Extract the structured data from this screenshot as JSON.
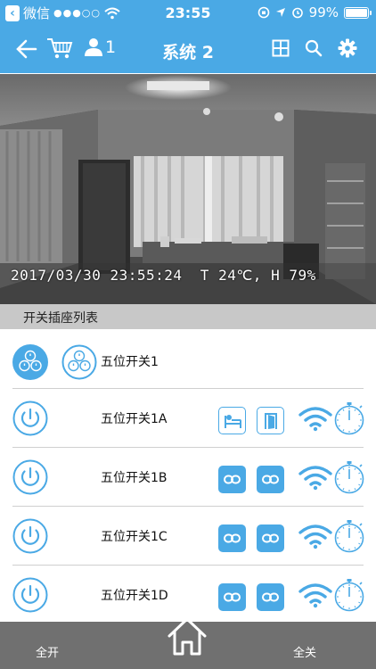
{
  "status_bar": {
    "back_glyph": "‹",
    "carrier": "微信",
    "signal": "●●●○○",
    "time": "23:55",
    "battery": "99%",
    "battery_level": 0.99
  },
  "nav": {
    "title": "系统 2",
    "user_count": "1",
    "icons": [
      "back-arrow-icon",
      "cart-icon",
      "user-icon",
      "grid-icon",
      "search-icon",
      "gear-icon"
    ]
  },
  "camera": {
    "timestamp": "2017/03/30 23:55:24",
    "sensor": "T 24℃, H 79%"
  },
  "section": {
    "title": "开关插座列表"
  },
  "group": {
    "name": "五位开关1"
  },
  "devices": [
    {
      "name": "五位开关1A",
      "actions": [
        "bed-icon",
        "door-icon"
      ],
      "style": "outline"
    },
    {
      "name": "五位开关1B",
      "actions": [
        "link-icon",
        "link-icon"
      ],
      "style": "filled"
    },
    {
      "name": "五位开关1C",
      "actions": [
        "link-icon",
        "link-icon"
      ],
      "style": "filled"
    },
    {
      "name": "五位开关1D",
      "actions": [
        "link-icon",
        "link-icon"
      ],
      "style": "filled"
    }
  ],
  "bottom": {
    "all_on": "全开",
    "all_off": "全关"
  },
  "colors": {
    "accent": "#4aa9e5",
    "bottom_bar": "#707070",
    "section_header": "#c8c8c8"
  }
}
